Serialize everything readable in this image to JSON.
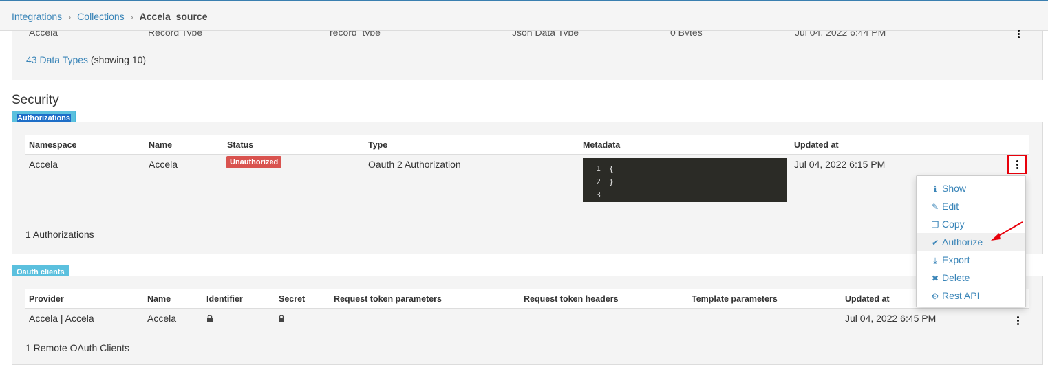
{
  "breadcrumb": {
    "items": [
      "Integrations",
      "Collections"
    ],
    "current": "Accela_source",
    "separator": "›"
  },
  "data_types": {
    "cut_row": [
      "Accela",
      "Record Type",
      "record_type",
      "Json Data Type",
      "0 Bytes",
      "Jul 04, 2022 6:44 PM"
    ],
    "count_link": "43 Data Types",
    "count_suffix": "(showing 10)"
  },
  "security": {
    "title": "Security",
    "authorizations": {
      "tab": "Authorizations",
      "headers": [
        "Namespace",
        "Name",
        "Status",
        "Type",
        "Metadata",
        "Updated at"
      ],
      "row": {
        "namespace": "Accela",
        "name": "Accela",
        "status": "Unauthorized",
        "type": "Oauth 2 Authorization",
        "metadata_lines": [
          {
            "n": "1",
            "text": "{"
          },
          {
            "n": "2",
            "text": "}"
          },
          {
            "n": "3",
            "text": ""
          }
        ],
        "updated_at": "Jul 04, 2022 6:15 PM"
      },
      "footer": "1 Authorizations"
    },
    "oauth_clients": {
      "tab": "Oauth clients",
      "headers": [
        "Provider",
        "Name",
        "Identifier",
        "Secret",
        "Request token parameters",
        "Request token headers",
        "Template parameters",
        "Updated at"
      ],
      "row": {
        "provider": "Accela | Accela",
        "name": "Accela",
        "updated_at": "Jul 04, 2022 6:45 PM"
      },
      "footer": "1 Remote OAuth Clients"
    }
  },
  "menu": {
    "items": [
      {
        "label": "Show",
        "icon": "info-circle-icon",
        "glyph": "ℹ"
      },
      {
        "label": "Edit",
        "icon": "pencil-icon",
        "glyph": "✎"
      },
      {
        "label": "Copy",
        "icon": "copy-icon",
        "glyph": "❐"
      },
      {
        "label": "Authorize",
        "icon": "check-icon",
        "glyph": "✔"
      },
      {
        "label": "Export",
        "icon": "download-icon",
        "glyph": "⤓"
      },
      {
        "label": "Delete",
        "icon": "times-icon",
        "glyph": "✖"
      },
      {
        "label": "Rest API",
        "icon": "cog-icon",
        "glyph": "⚙"
      }
    ]
  },
  "colors": {
    "accent": "#3a85b8",
    "danger": "#d9534f",
    "tab": "#5bc0de",
    "highlight": "#e8000b"
  }
}
